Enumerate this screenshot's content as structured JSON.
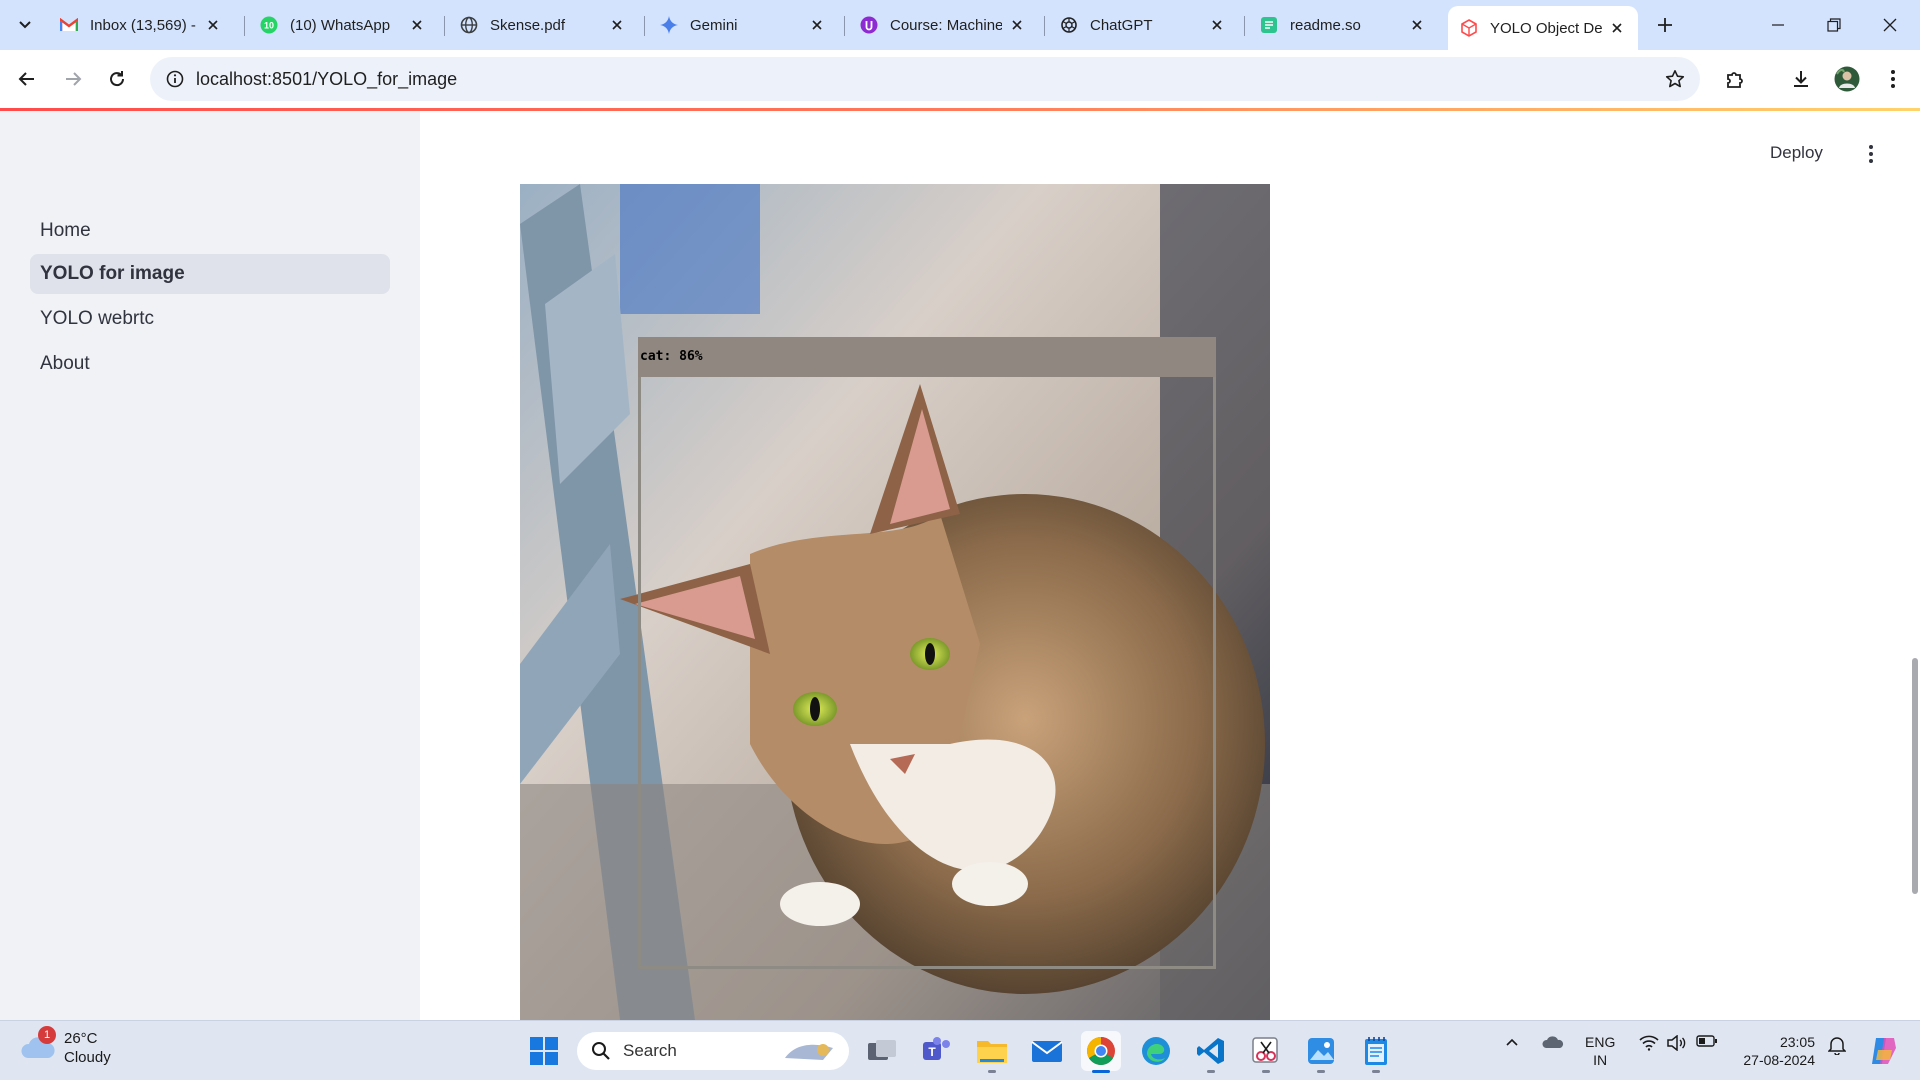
{
  "browser": {
    "tabs": [
      {
        "title": "Inbox (13,569) - ",
        "icon": "gmail-icon"
      },
      {
        "title": "(10) WhatsApp",
        "icon": "whatsapp-icon"
      },
      {
        "title": "Skense.pdf",
        "icon": "globe-icon"
      },
      {
        "title": "Gemini",
        "icon": "gemini-icon"
      },
      {
        "title": "Course: Machine",
        "icon": "course-icon"
      },
      {
        "title": "ChatGPT",
        "icon": "chatgpt-icon"
      },
      {
        "title": "readme.so",
        "icon": "readme-icon"
      },
      {
        "title": "YOLO Object De",
        "icon": "streamlit-icon",
        "active": true
      }
    ],
    "url": "localhost:8501/YOLO_for_image"
  },
  "sidebar": {
    "items": [
      {
        "label": "Home"
      },
      {
        "label": "YOLO for image",
        "active": true
      },
      {
        "label": "YOLO webrtc"
      },
      {
        "label": "About"
      }
    ]
  },
  "header": {
    "deploy_label": "Deploy"
  },
  "detection": {
    "label": "cat: 86%",
    "class": "cat",
    "confidence": 0.86
  },
  "taskbar": {
    "weather_temp": "26°C",
    "weather_desc": "Cloudy",
    "weather_badge": "1",
    "search_placeholder": "Search",
    "lang_line1": "ENG",
    "lang_line2": "IN",
    "time": "23:05",
    "date": "27-08-2024"
  },
  "colors": {
    "accent": "#ff4b4b",
    "sidebar_bg": "#f0f2f6",
    "tabstrip_bg": "#d3e3fd"
  }
}
